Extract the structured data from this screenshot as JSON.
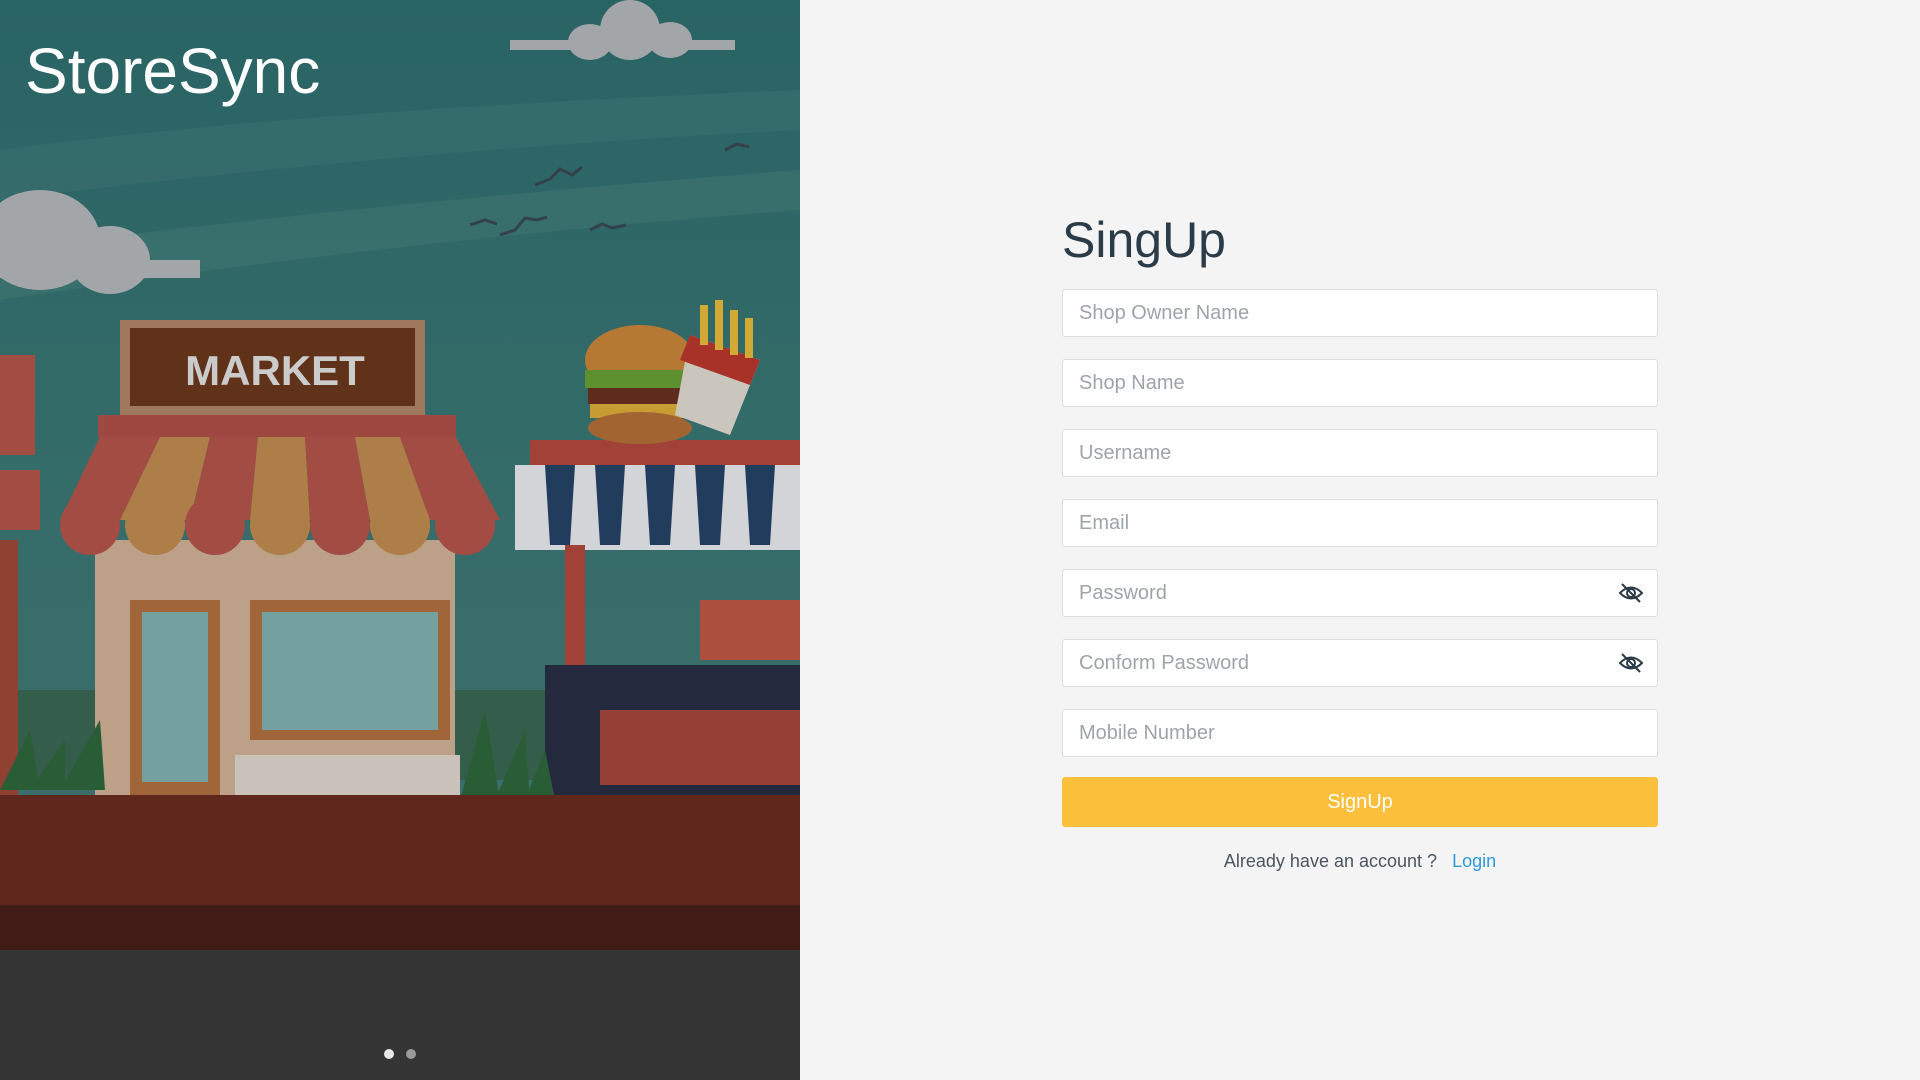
{
  "brand": {
    "name": "StoreSync"
  },
  "illustration": {
    "sign_text": "MARKET"
  },
  "carousel": {
    "slide_count": 2,
    "active_index": 0
  },
  "form": {
    "title": "SingUp",
    "fields": [
      {
        "name": "owner-name",
        "placeholder": "Shop Owner Name",
        "value": ""
      },
      {
        "name": "shop-name",
        "placeholder": "Shop Name",
        "value": ""
      },
      {
        "name": "username",
        "placeholder": "Username",
        "value": ""
      },
      {
        "name": "email",
        "placeholder": "Email",
        "value": ""
      },
      {
        "name": "password",
        "placeholder": "Password",
        "value": "",
        "toggle_icon": "eye-slash-icon"
      },
      {
        "name": "confirm-password",
        "placeholder": "Conform Password",
        "value": "",
        "toggle_icon": "eye-slash-icon"
      },
      {
        "name": "mobile",
        "placeholder": "Mobile Number",
        "value": ""
      }
    ],
    "submit_label": "SignUp",
    "login_prompt": "Already have an account ?",
    "login_link": "Login"
  },
  "colors": {
    "accent": "#fbbf3b",
    "link": "#2c9adb",
    "title": "#2b3b47",
    "background": "#f4f4f4"
  }
}
